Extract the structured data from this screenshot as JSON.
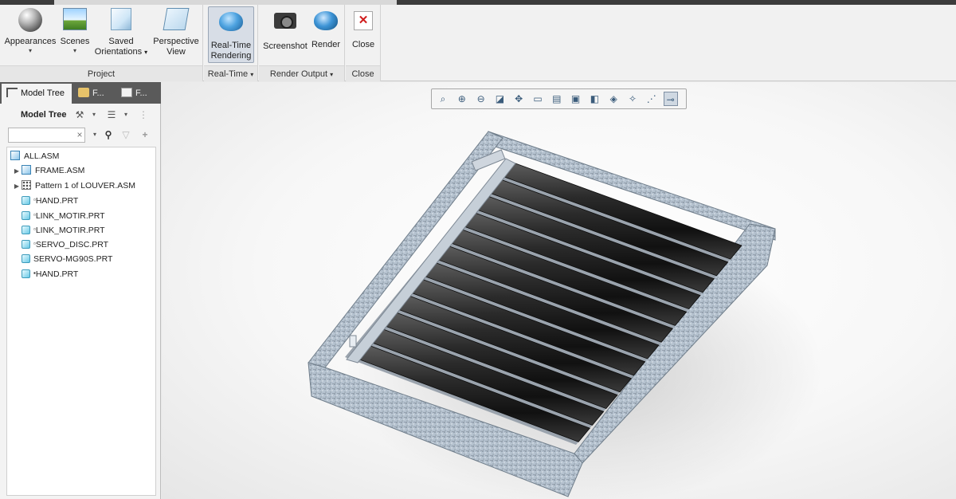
{
  "ribbon": {
    "groups": [
      {
        "label": "Project",
        "buttons": [
          {
            "label": "Appearances",
            "icon": "appearances-sphere-icon",
            "has_menu": true
          },
          {
            "label": "Scenes",
            "icon": "scenes-icon",
            "has_menu": true
          },
          {
            "label": "Saved Orientations",
            "line1": "Saved",
            "line2": "Orientations",
            "icon": "saved-orientations-icon",
            "has_menu": true
          },
          {
            "label": "Perspective View",
            "line1": "Perspective",
            "line2": "View",
            "icon": "perspective-view-icon",
            "has_menu": false
          }
        ]
      },
      {
        "label": "Real-Time",
        "buttons": [
          {
            "label": "Real-Time Rendering",
            "line1": "Real-Time",
            "line2": "Rendering",
            "icon": "teapot-icon",
            "active": true
          }
        ]
      },
      {
        "label": "Render Output",
        "buttons": [
          {
            "label": "Screenshot",
            "icon": "camera-icon"
          },
          {
            "label": "Render",
            "icon": "render-teapot-icon"
          }
        ]
      },
      {
        "label": "Close",
        "buttons": [
          {
            "label": "Close",
            "icon": "close-icon"
          }
        ]
      }
    ],
    "caret": "▾"
  },
  "left_panel": {
    "tabs": [
      {
        "label": "Model Tree",
        "active": true
      },
      {
        "label": "F...",
        "active": false
      },
      {
        "label": "F...",
        "active": false
      }
    ],
    "title": "Model Tree",
    "search": {
      "value": "",
      "clear_glyph": "×"
    },
    "tree": [
      {
        "label": "ALL.ASM",
        "kind": "asm",
        "indent": 0,
        "expandable": false
      },
      {
        "label": "FRAME.ASM",
        "kind": "asm",
        "indent": 1,
        "expandable": true
      },
      {
        "label": "Pattern 1 of LOUVER.ASM",
        "kind": "pattern",
        "indent": 1,
        "expandable": true
      },
      {
        "label": "HAND.PRT",
        "kind": "prt",
        "indent": 1,
        "expandable": false,
        "marker": "▫"
      },
      {
        "label": "LINK_MOTIR.PRT",
        "kind": "prt",
        "indent": 1,
        "expandable": false,
        "marker": "▫"
      },
      {
        "label": "LINK_MOTIR.PRT",
        "kind": "prt",
        "indent": 1,
        "expandable": false,
        "marker": "▫"
      },
      {
        "label": "SERVO_DISC.PRT",
        "kind": "prt",
        "indent": 1,
        "expandable": false,
        "marker": "▫"
      },
      {
        "label": "SERVO-MG90S.PRT",
        "kind": "prt",
        "indent": 1,
        "expandable": false,
        "marker": ""
      },
      {
        "label": "HAND.PRT",
        "kind": "prt",
        "indent": 1,
        "expandable": false,
        "marker": "▪"
      }
    ]
  },
  "view_toolbar": {
    "tools": [
      "refit-icon",
      "zoom-in-icon",
      "zoom-out-icon",
      "repaint-icon",
      "pan-icon",
      "view-manager-icon",
      "saved-views-icon",
      "display-style-icon",
      "named-views-icon",
      "spin-center-icon",
      "annotation-display-icon",
      "datum-display-icon",
      "sketch-view-icon"
    ],
    "active_index": 12
  },
  "colors": {
    "ribbon_bg": "#f1f1f1",
    "tab_bar": "#5a5a5a",
    "viewport_bg": "#ffffff",
    "frame_metal": "#a9b7c6",
    "louver_dark": "#1c1c1c"
  }
}
